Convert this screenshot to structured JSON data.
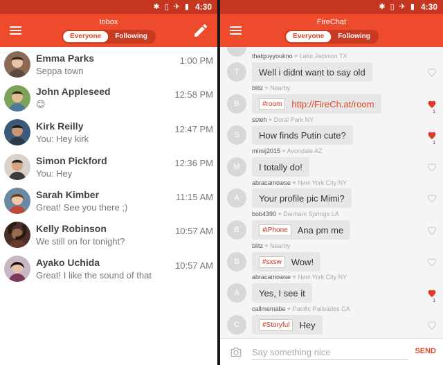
{
  "status": {
    "time": "4:30"
  },
  "colors": {
    "accent": "#ee4a2c",
    "status_bar": "#c4361f",
    "heart_active": "#e03a2a"
  },
  "inbox": {
    "title": "Inbox",
    "tabs": [
      {
        "label": "Everyone",
        "active": true
      },
      {
        "label": "Following",
        "active": false
      }
    ],
    "conversations": [
      {
        "name": "Emma Parks",
        "preview": "Seppa town",
        "time": "1:00 PM"
      },
      {
        "name": "John Appleseed",
        "preview": "😊",
        "time": "12:58 PM"
      },
      {
        "name": "Kirk Reilly",
        "preview": "You: Hey kirk",
        "time": "12:47 PM"
      },
      {
        "name": "Simon Pickford",
        "preview": "You: Hey",
        "time": "12:36 PM"
      },
      {
        "name": "Sarah Kimber",
        "preview": "Great! See you there ;)",
        "time": "11:15 AM"
      },
      {
        "name": "Kelly Robinson",
        "preview": "We still on for tonight?",
        "time": "10:57 AM"
      },
      {
        "name": "Ayako Uchida",
        "preview": "Great! I like the sound of that",
        "time": "10:57 AM"
      }
    ]
  },
  "firechat": {
    "title": "FireChat",
    "tabs": [
      {
        "label": "Everyone",
        "active": true
      },
      {
        "label": "Following",
        "active": false
      }
    ],
    "messages": [
      {
        "user": "thatguyyoukno",
        "location": "Lake Jackson TX",
        "initial": "T",
        "tag": "",
        "text": "Well i didnt want to say old",
        "liked": false,
        "likes": ""
      },
      {
        "user": "blitz",
        "location": "Nearby",
        "initial": "B",
        "tag": "#room",
        "text": "http://FireCh.at/room",
        "link": true,
        "liked": true,
        "likes": "1"
      },
      {
        "user": "ssteh",
        "location": "Doral Park NY",
        "initial": "S",
        "tag": "",
        "text": "How finds Putin cute?",
        "liked": true,
        "likes": "1"
      },
      {
        "user": "mimij2015",
        "location": "Avondale AZ",
        "initial": "M",
        "tag": "",
        "text": "I totally do!",
        "liked": false,
        "likes": ""
      },
      {
        "user": "abracamowse",
        "location": "New York City NY",
        "initial": "A",
        "tag": "",
        "text": "Your profile pic Mimi?",
        "liked": false,
        "likes": ""
      },
      {
        "user": "bob4390",
        "location": "Denham Springs LA",
        "initial": "B",
        "tag": "#iPhone",
        "text": "Ana pm me",
        "liked": false,
        "likes": ""
      },
      {
        "user": "blitz",
        "location": "Nearby",
        "initial": "B",
        "tag": "#sxsw",
        "text": "Wow!",
        "liked": false,
        "likes": ""
      },
      {
        "user": "abracamowse",
        "location": "New York City NY",
        "initial": "A",
        "tag": "",
        "text": "Yes, I see it",
        "liked": true,
        "likes": "1"
      },
      {
        "user": "callmemabe",
        "location": "Pacific Palisades CA",
        "initial": "C",
        "tag": "#Storyful",
        "text": "Hey",
        "liked": false,
        "likes": ""
      }
    ],
    "input": {
      "placeholder": "Say something nice",
      "value": ""
    },
    "send_label": "SEND"
  }
}
